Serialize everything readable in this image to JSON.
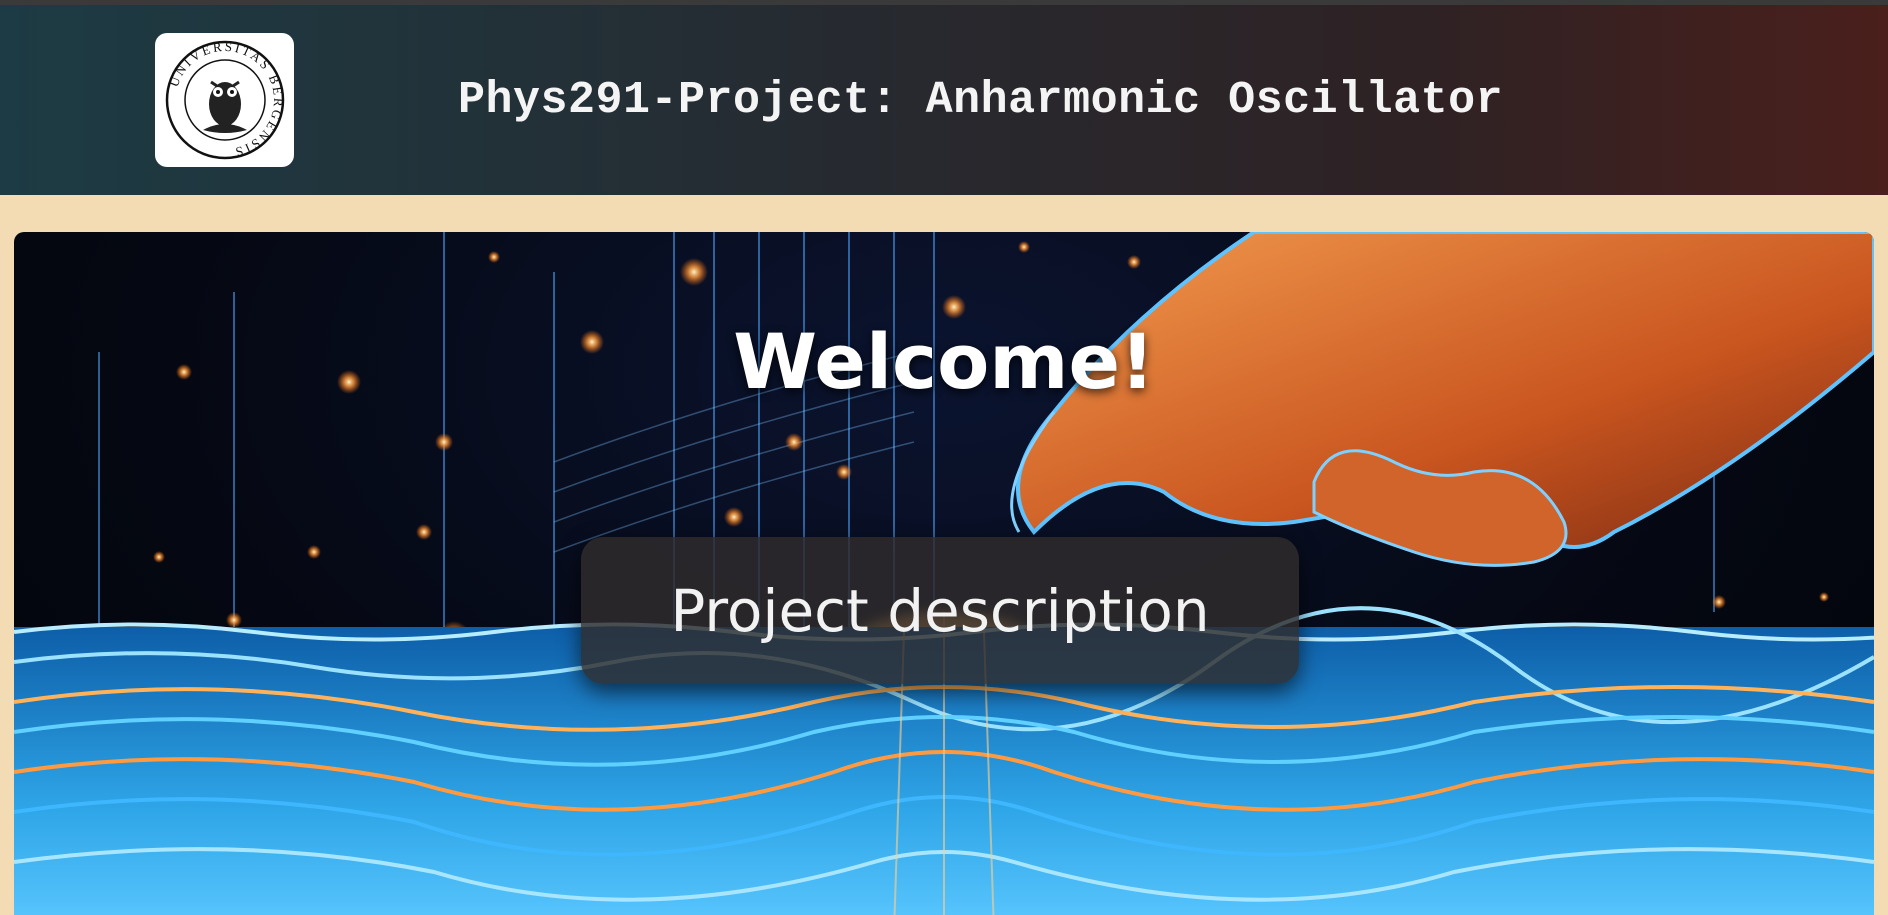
{
  "header": {
    "title": "Phys291-Project: Anharmonic Oscillator",
    "logo": {
      "alt": "Universitas Bergensis seal",
      "ring_text": "UNIVERSITAS BERGENSIS",
      "icon": "owl-seal-icon"
    }
  },
  "hero": {
    "heading": "Welcome!",
    "button_label": "Project description",
    "colors": {
      "wave_blue": "#3fb7ff",
      "glow_orange": "#ff9a3c",
      "hand_orange": "#d8642a",
      "page_background": "#f3dcb3"
    }
  }
}
